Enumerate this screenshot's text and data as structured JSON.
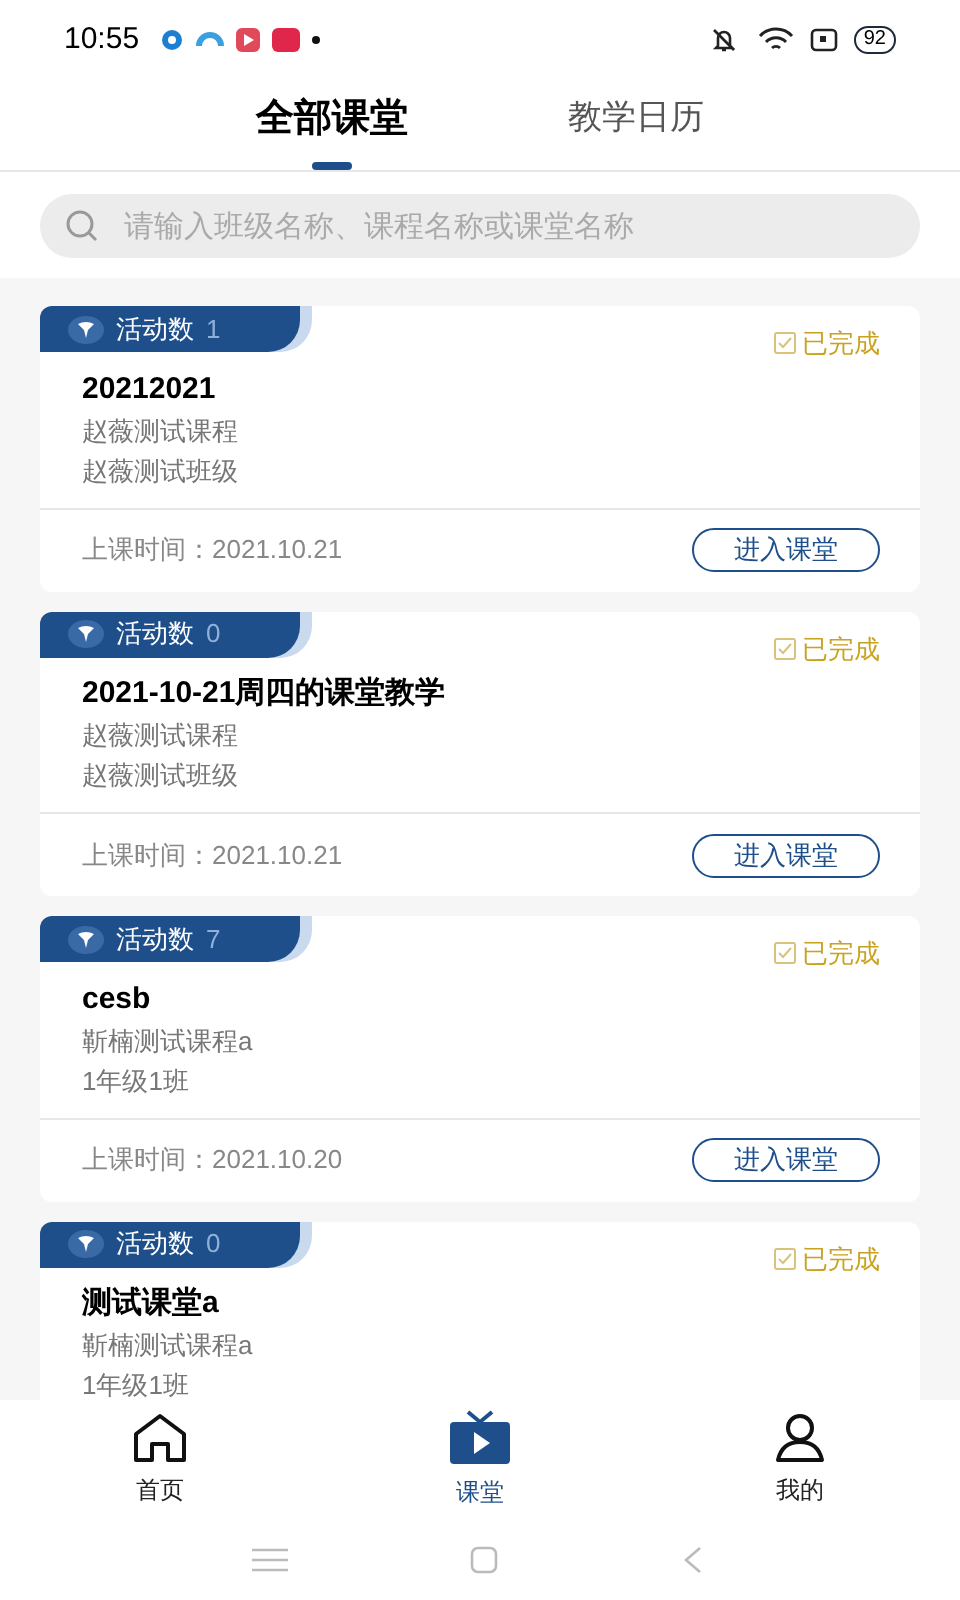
{
  "status_bar": {
    "time": "10:55",
    "battery": "92"
  },
  "tabs": [
    {
      "label": "全部课堂",
      "selected": true
    },
    {
      "label": "教学日历",
      "selected": false
    }
  ],
  "search": {
    "placeholder": "请输入班级名称、课程名称或课堂名称"
  },
  "classes": [
    {
      "activity_label": "活动数",
      "activity_count": "1",
      "status": "已完成",
      "title": "20212021",
      "course": "赵薇测试课程",
      "class_name": "赵薇测试班级",
      "time": "上课时间：2021.10.21",
      "button": "进入课堂"
    },
    {
      "activity_label": "活动数",
      "activity_count": "0",
      "status": "已完成",
      "title": "2021-10-21周四的课堂教学",
      "course": "赵薇测试课程",
      "class_name": "赵薇测试班级",
      "time": "上课时间：2021.10.21",
      "button": "进入课堂"
    },
    {
      "activity_label": "活动数",
      "activity_count": "7",
      "status": "已完成",
      "title": "cesb",
      "course": "靳楠测试课程a",
      "class_name": "1年级1班",
      "time": "上课时间：2021.10.20",
      "button": "进入课堂"
    },
    {
      "activity_label": "活动数",
      "activity_count": "0",
      "status": "已完成",
      "title": "测试课堂a",
      "course": "靳楠测试课程a",
      "class_name": "1年级1班"
    }
  ],
  "nav": [
    {
      "kind": "home",
      "label": "首页",
      "selected": false
    },
    {
      "kind": "tv",
      "label": "课堂",
      "selected": true
    },
    {
      "kind": "person",
      "label": "我的",
      "selected": false
    }
  ]
}
